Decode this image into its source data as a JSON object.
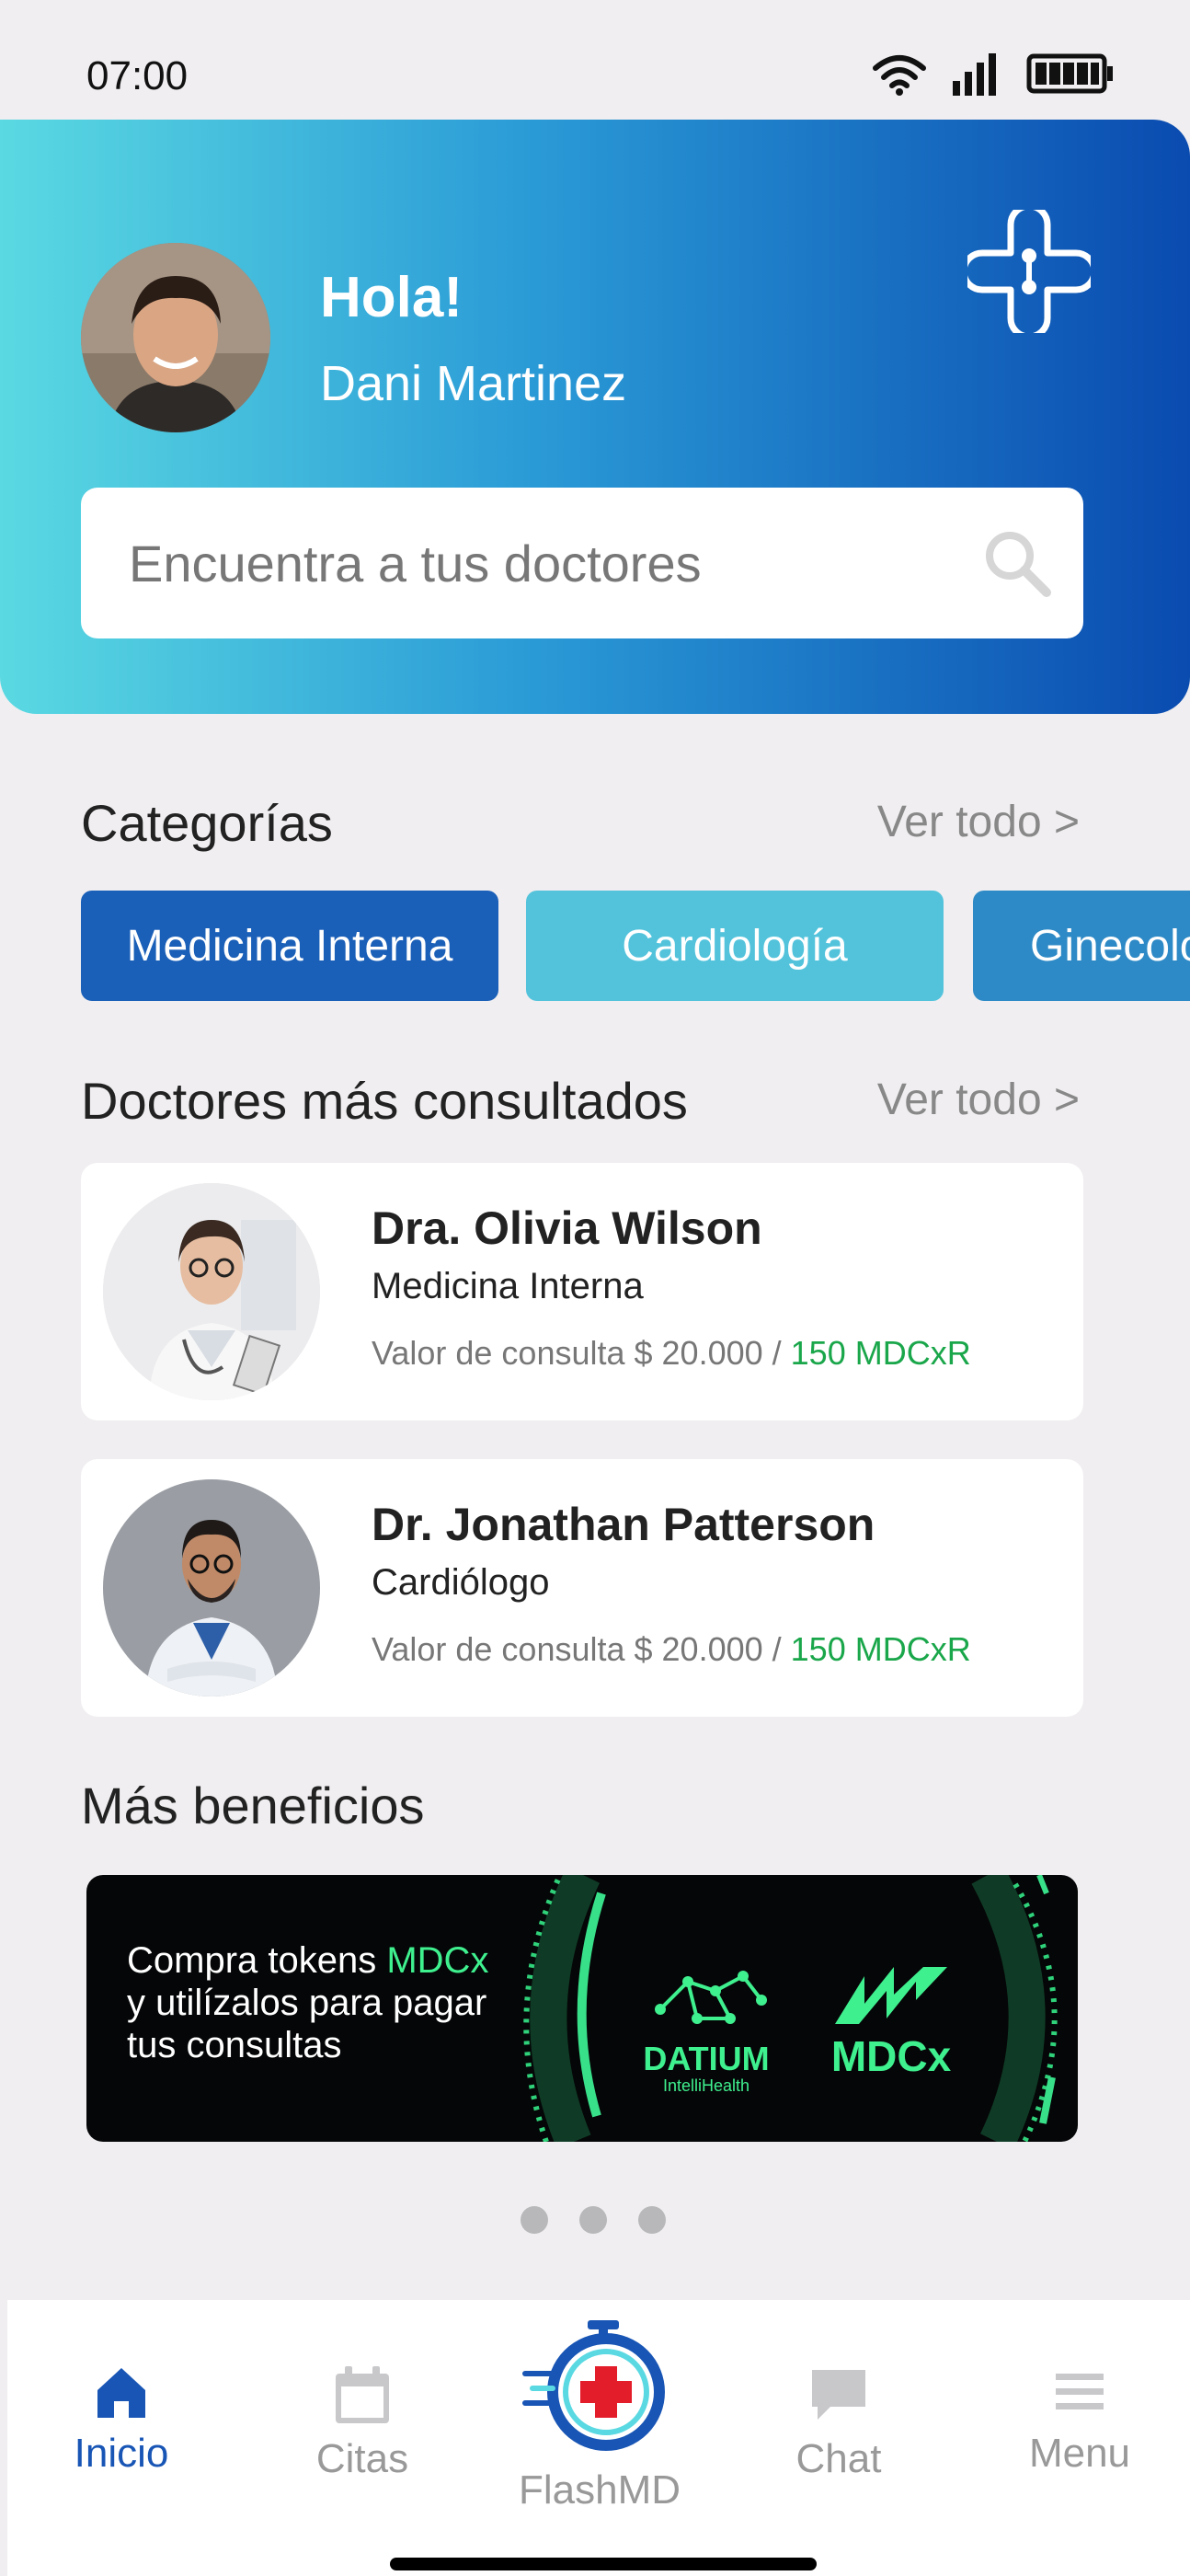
{
  "status": {
    "time": "07:00"
  },
  "header": {
    "greeting": "Hola!",
    "user_name": "Dani Martinez",
    "search_placeholder": "Encuentra a tus doctores"
  },
  "categories": {
    "title": "Categorías",
    "see_all": "Ver todo >",
    "items": [
      {
        "label": "Medicina Interna",
        "color": "#1a5fb8"
      },
      {
        "label": "Cardiología",
        "color": "#53c3dc"
      },
      {
        "label": "Ginecología",
        "color": "#2e8ac6"
      }
    ]
  },
  "doctors": {
    "title": "Doctores más consultados",
    "see_all": "Ver todo >",
    "items": [
      {
        "name": "Dra. Olivia Wilson",
        "specialty": "Medicina Interna",
        "price_text": "Valor de consulta $ 20.000 / ",
        "token_text": "150 MDCxR"
      },
      {
        "name": "Dr. Jonathan Patterson",
        "specialty": "Cardiólogo",
        "price_text": "Valor de consulta $ 20.000 / ",
        "token_text": "150 MDCxR"
      }
    ]
  },
  "benefits": {
    "title": "Más beneficios",
    "banner_line1_pre": "Compra tokens ",
    "banner_line1_hl": "MDCx",
    "banner_line2": "y utilízalos para pagar",
    "banner_line3": "tus consultas",
    "logo1_name": "DATIUM",
    "logo1_sub": "IntelliHealth",
    "logo2_name": "MDCx"
  },
  "nav": {
    "items": [
      {
        "label": "Inicio",
        "icon": "home-icon",
        "active": true
      },
      {
        "label": "Citas",
        "icon": "calendar-icon",
        "active": false
      },
      {
        "label": "FlashMD",
        "icon": "flashmd-icon",
        "active": false
      },
      {
        "label": "Chat",
        "icon": "chat-icon",
        "active": false
      },
      {
        "label": "Menu",
        "icon": "menu-icon",
        "active": false
      }
    ]
  },
  "colors": {
    "header_gradient_start": "#5ad9e2",
    "header_gradient_end": "#0a4bb0",
    "accent": "#1855b5",
    "token_green": "#1aa64a",
    "banner_green": "#3ff08f"
  }
}
